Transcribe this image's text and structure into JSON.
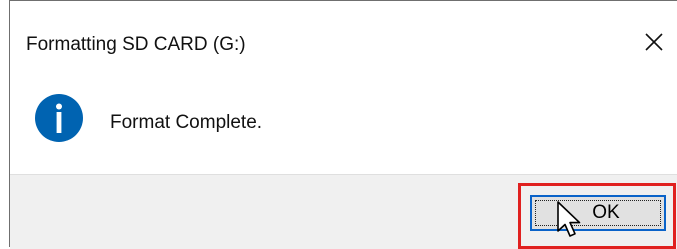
{
  "dialog": {
    "title": "Formatting SD CARD (G:)",
    "message": "Format Complete.",
    "ok_label": "OK"
  },
  "icons": {
    "close": "close-icon",
    "info": "information-icon",
    "cursor": "mouse-pointer-icon"
  },
  "colors": {
    "info_blue": "#0063b1",
    "button_border_focus": "#0a63c9",
    "button_face": "#e1e1e1",
    "footer_bg": "#f0f0f0",
    "highlight_red": "#e0201f"
  }
}
